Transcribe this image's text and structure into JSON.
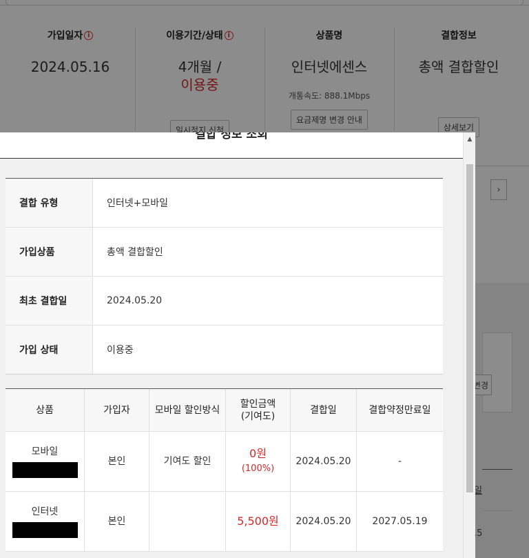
{
  "background": {
    "columns": [
      {
        "header": "가입일자",
        "has_info": true,
        "value": "2024.05.16"
      },
      {
        "header": "이용기간/상태",
        "has_info": true,
        "value": "4개월 /",
        "value2": "이용중",
        "button": "일시정지 신청"
      },
      {
        "header": "상품명",
        "has_info": false,
        "value": "인터넷에센스",
        "sub": "개통속도: 888.1Mbps",
        "button": "요금제명 변경 안내"
      },
      {
        "header": "결합정보",
        "has_info": false,
        "value": "총액 결합할인",
        "button": "상세보기"
      }
    ],
    "info_icon": "info-circle-icon",
    "chevron": "›",
    "card_button": "변경",
    "table_head": "일",
    "table_cell": ".5"
  },
  "modal": {
    "title": "결합 정보 조회",
    "info_rows": [
      {
        "label": "결합 유형",
        "value": "인터넷+모바일"
      },
      {
        "label": "가입상품",
        "value": "총액 결합할인"
      },
      {
        "label": "최초 결합일",
        "value": "2024.05.20"
      },
      {
        "label": "가입 상태",
        "value": "이용중"
      }
    ],
    "product_headers": [
      "상품",
      "가입자",
      "모바일 할인방식",
      "할인금액\n(기여도)",
      "결합일",
      "결합약정만료일"
    ],
    "products": [
      {
        "product": "모바일",
        "subscriber": "본인",
        "method": "기여도 할인",
        "amount": "0원",
        "contribution": "(100%)",
        "date": "2024.05.20",
        "expiry": "-"
      },
      {
        "product": "인터넷",
        "subscriber": "본인",
        "method": "",
        "amount": "5,500원",
        "contribution": "",
        "date": "2024.05.20",
        "expiry": "2027.05.19"
      }
    ]
  },
  "colors": {
    "accent_red": "#d62828",
    "overlay": "rgba(0,0,0,0.45)"
  }
}
